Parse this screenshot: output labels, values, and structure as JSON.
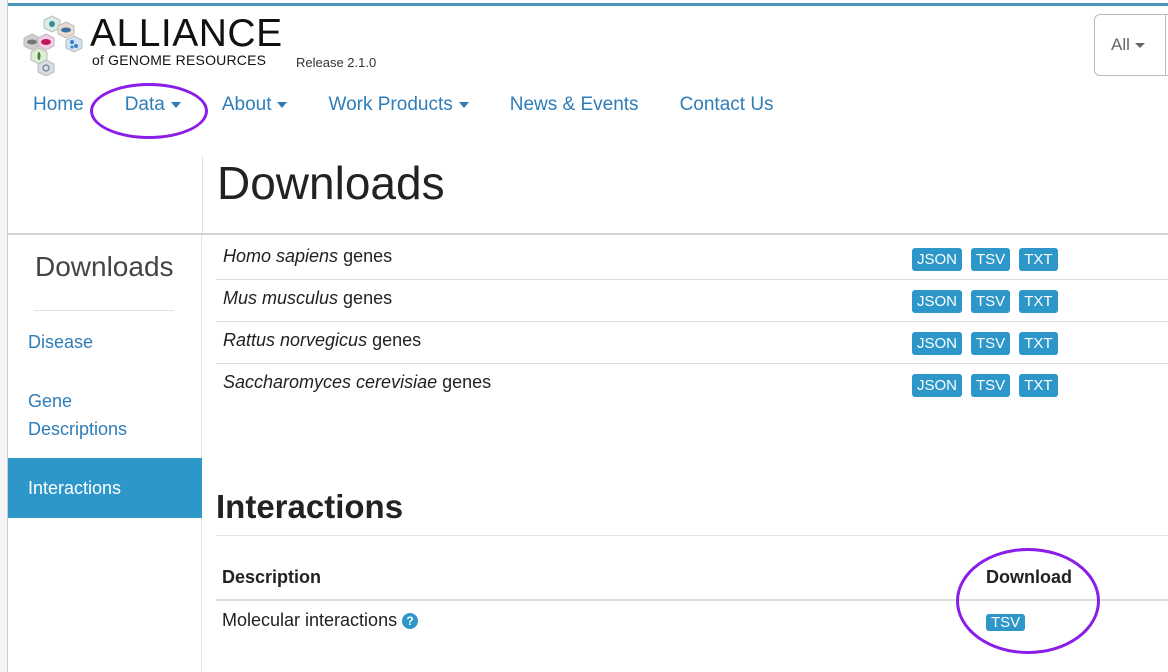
{
  "header": {
    "logo_title": "ALLIANCE",
    "logo_subtitle": "of GENOME RESOURCES",
    "release": "Release 2.1.0",
    "search_category": "All"
  },
  "nav": {
    "items": [
      {
        "label": "Home",
        "dropdown": false
      },
      {
        "label": "Data",
        "dropdown": true
      },
      {
        "label": "About",
        "dropdown": true
      },
      {
        "label": "Work Products",
        "dropdown": true
      },
      {
        "label": "News & Events",
        "dropdown": false
      },
      {
        "label": "Contact Us",
        "dropdown": false
      }
    ]
  },
  "page": {
    "title": "Downloads"
  },
  "sidebar": {
    "title": "Downloads",
    "items": [
      {
        "label": "Disease",
        "active": false
      },
      {
        "label": "Gene Descriptions",
        "active": false
      },
      {
        "label": "Interactions",
        "active": true
      }
    ]
  },
  "gene_descriptions": {
    "rows": [
      {
        "species": "Homo sapiens",
        "suffix": "genes",
        "formats": [
          "JSON",
          "TSV",
          "TXT"
        ]
      },
      {
        "species": "Mus musculus",
        "suffix": "genes",
        "formats": [
          "JSON",
          "TSV",
          "TXT"
        ]
      },
      {
        "species": "Rattus norvegicus",
        "suffix": "genes",
        "formats": [
          "JSON",
          "TSV",
          "TXT"
        ]
      },
      {
        "species": "Saccharomyces cerevisiae",
        "suffix": "genes",
        "formats": [
          "JSON",
          "TSV",
          "TXT"
        ]
      }
    ]
  },
  "interactions": {
    "title": "Interactions",
    "columns": [
      "Description",
      "Download"
    ],
    "rows": [
      {
        "description": "Molecular interactions",
        "help_icon": "question-circle-icon",
        "formats": [
          "TSV"
        ]
      }
    ]
  },
  "colors": {
    "accent": "#2c97c8",
    "link": "#2e7db8",
    "annotation": "#8a1ee8",
    "top_bar": "#4a95be"
  }
}
